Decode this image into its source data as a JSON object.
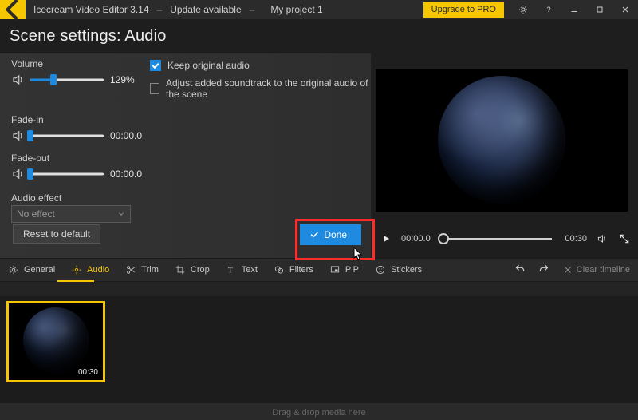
{
  "titlebar": {
    "app_name": "Icecream Video Editor 3.14",
    "update_link": "Update available",
    "project_name": "My project 1",
    "upgrade_label": "Upgrade to PRO"
  },
  "section_title": "Scene settings: Audio",
  "settings": {
    "volume": {
      "label": "Volume",
      "value_text": "129%",
      "fill_pct": 32
    },
    "keep_original": {
      "label": "Keep original audio",
      "checked": true
    },
    "adjust_soundtrack": {
      "label": "Adjust added soundtrack to the original audio of the scene",
      "checked": false
    },
    "fade_in": {
      "label": "Fade-in",
      "value_text": "00:00.0",
      "fill_pct": 0
    },
    "fade_out": {
      "label": "Fade-out",
      "value_text": "00:00.0",
      "fill_pct": 0
    },
    "audio_effect": {
      "label": "Audio effect",
      "selected": "No effect"
    },
    "reset_label": "Reset to default",
    "done_label": "Done"
  },
  "player": {
    "current_time": "00:00.0",
    "duration": "00:30"
  },
  "tabs": {
    "general": "General",
    "audio": "Audio",
    "trim": "Trim",
    "crop": "Crop",
    "text": "Text",
    "filters": "Filters",
    "pip": "PiP",
    "stickers": "Stickers",
    "clear_timeline": "Clear timeline"
  },
  "clip": {
    "duration": "00:30"
  },
  "bottom_hint": "Drag & drop media here"
}
